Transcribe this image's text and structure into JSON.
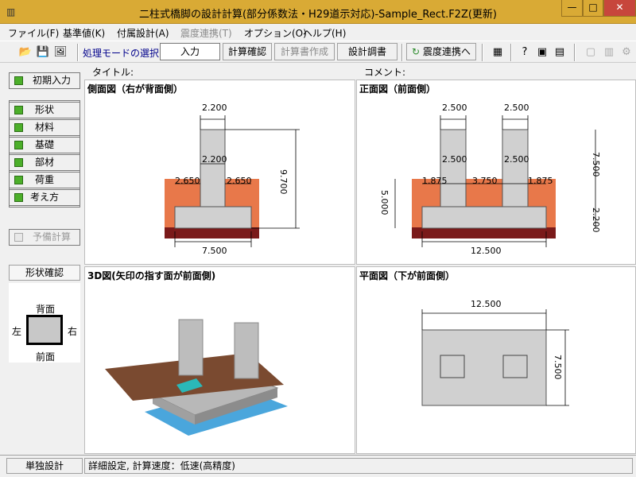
{
  "window": {
    "title": "二柱式橋脚の設計計算(部分係数法・H29道示対応)-Sample_Rect.F2Z(更新)",
    "min": "—",
    "max": "□",
    "close": "✕"
  },
  "menu": [
    {
      "label": "ファイル(F)",
      "disabled": false
    },
    {
      "label": "基準値(K)",
      "disabled": false
    },
    {
      "label": "付属設計(A)",
      "disabled": false
    },
    {
      "label": "震度連携(T)",
      "disabled": true
    },
    {
      "label": "オプション(O)",
      "disabled": false
    },
    {
      "label": "ヘルプ(H)",
      "disabled": false
    }
  ],
  "toolbar": {
    "mode_label": "処理モードの選択",
    "input": "入力",
    "calc_check": "計算確認",
    "report_create": "計算書作成",
    "design_report": "設計調書",
    "seismic_link": "震度連携へ"
  },
  "sidebar": {
    "initial_input": "初期入力",
    "items": [
      "形状",
      "材料",
      "基礎",
      "部材",
      "荷重",
      "考え方"
    ],
    "preliminary": "予備計算",
    "shape_check": "形状確認",
    "orient": {
      "back": "背面",
      "front": "前面",
      "left": "左",
      "right": "右"
    }
  },
  "headers": {
    "title": "タイトル:",
    "comment": "コメント:"
  },
  "views": {
    "side": {
      "title": "側面図（右が背面側）",
      "dims": {
        "top": "2.200",
        "col": "2.200",
        "left": "2.650",
        "right": "2.650",
        "height": "9.700",
        "bottom": "7.500"
      }
    },
    "front": {
      "title": "正面図（前面側）",
      "dims": {
        "top1": "2.500",
        "top2": "2.500",
        "col1": "2.500",
        "col2": "2.500",
        "a": "1.875",
        "b": "3.750",
        "c": "1.875",
        "left": "5.000",
        "h1": "7.500",
        "h2": "2.200",
        "bottom": "12.500"
      }
    },
    "iso": {
      "title": "3D図(矢印の指す面が前面側)"
    },
    "plan": {
      "title": "平面図（下が前面側）",
      "dims": {
        "width": "12.500",
        "depth": "7.500"
      }
    }
  },
  "status": {
    "mode": "単独設計",
    "info": "詳細設定, 計算速度：低速(高精度)"
  }
}
